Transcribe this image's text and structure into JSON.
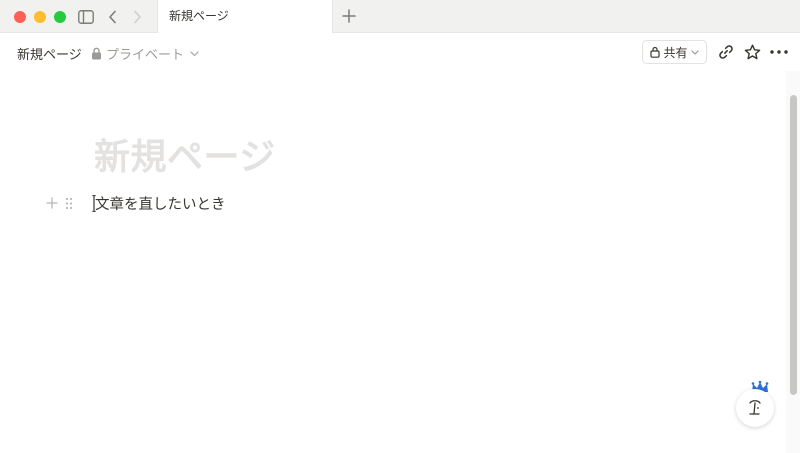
{
  "window": {
    "tab_title": "新規ページ"
  },
  "topbar": {
    "breadcrumb_title": "新規ページ",
    "privacy_label": "プライベート",
    "share_label": "共有"
  },
  "page": {
    "title_placeholder": "新規ページ",
    "blocks": [
      {
        "text": "文章を直したいとき"
      }
    ]
  },
  "icons": {
    "sidebar_toggle": "sidebar-icon",
    "back": "chevron-left-icon",
    "forward": "chevron-right-icon",
    "new_tab": "plus-icon",
    "privacy": "lock-icon",
    "link": "link-icon",
    "favorite": "star-icon",
    "more": "more-horizontal-icon",
    "help": "help-assistant-icon"
  },
  "colors": {
    "traffic_red": "#fe5f57",
    "traffic_yellow": "#febc2e",
    "traffic_green": "#28c840",
    "title_placeholder": "#e3e2e0",
    "muted_text": "#9b9a97",
    "body_text": "#37352f",
    "crown_blue": "#2f6fd6"
  }
}
